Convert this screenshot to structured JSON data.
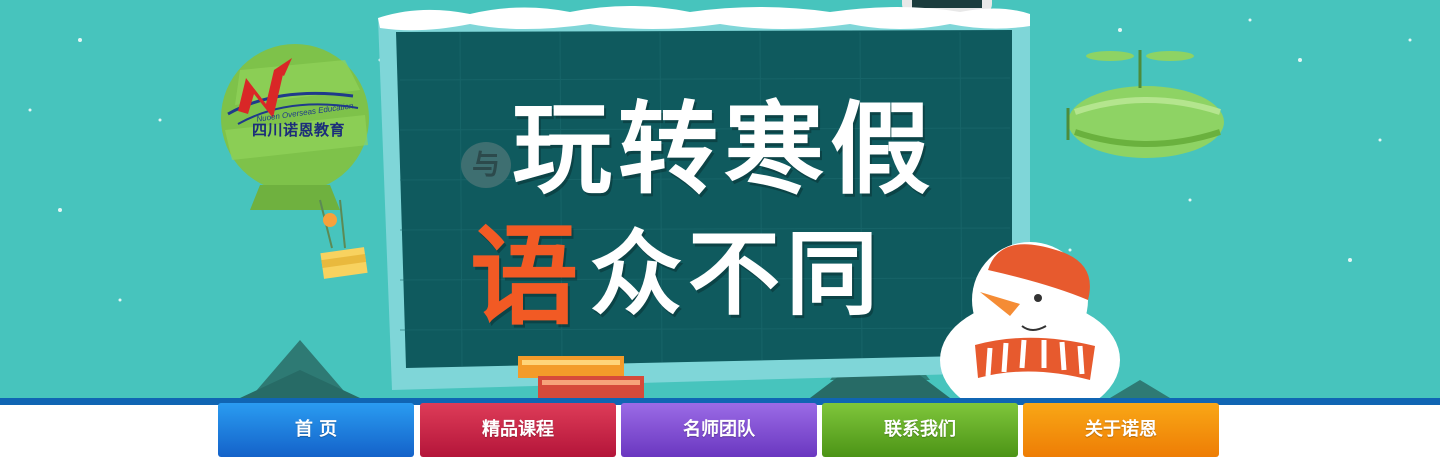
{
  "banner": {
    "headline_line1": "玩转寒假",
    "headline_line2_highlight": "语",
    "headline_line2_rest": "众不同",
    "small_char": "与",
    "colors": {
      "background": "#47c4bd",
      "blackboard": "#0f5a5e",
      "board_frame": "#7fd6d8",
      "highlight": "#f25a24"
    }
  },
  "logo": {
    "english_text": "Nuoen Overseas Education",
    "chinese_text": "四川诺恩教育"
  },
  "nav": {
    "items": [
      {
        "label": "首  页",
        "color": "#1d7fe0"
      },
      {
        "label": "精品课程",
        "color": "#c8234a"
      },
      {
        "label": "名师团队",
        "color": "#8350d6"
      },
      {
        "label": "联系我们",
        "color": "#64ad27"
      },
      {
        "label": "关于诺恩",
        "color": "#f4920b"
      }
    ]
  }
}
